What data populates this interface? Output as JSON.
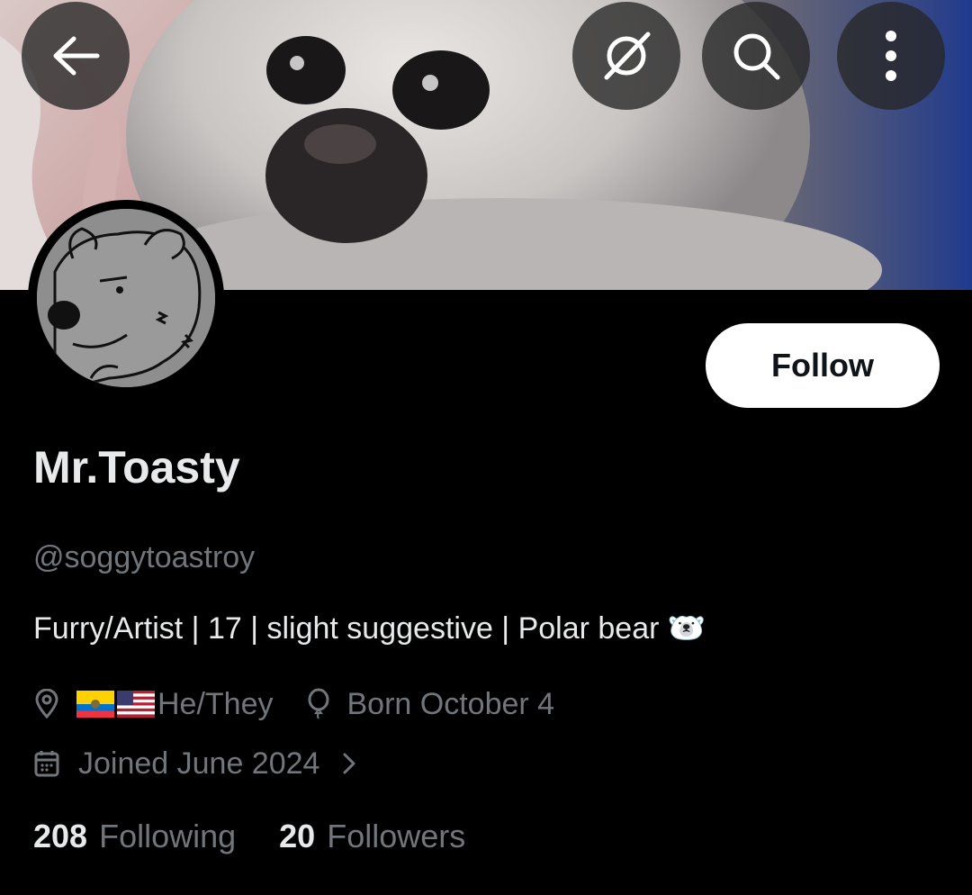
{
  "header": {
    "back_icon": "arrow-left-icon",
    "grok_icon": "grok-slash-icon",
    "search_icon": "search-icon",
    "more_icon": "more-vertical-icon"
  },
  "profile": {
    "follow_label": "Follow",
    "display_name": "Mr.Toasty",
    "handle": "@soggytoastroy",
    "bio": "Furry/Artist | 17 | slight suggestive | Polar bear 🐻‍❄️",
    "location": "He/They",
    "birthday": "Born October 4",
    "joined": "Joined June 2024",
    "following_count": "208",
    "following_label": "Following",
    "followers_count": "20",
    "followers_label": "Followers"
  },
  "colors": {
    "background": "#000000",
    "primary_text": "#e7e9ea",
    "secondary_text": "#71767b",
    "follow_button_bg": "#ffffff"
  }
}
